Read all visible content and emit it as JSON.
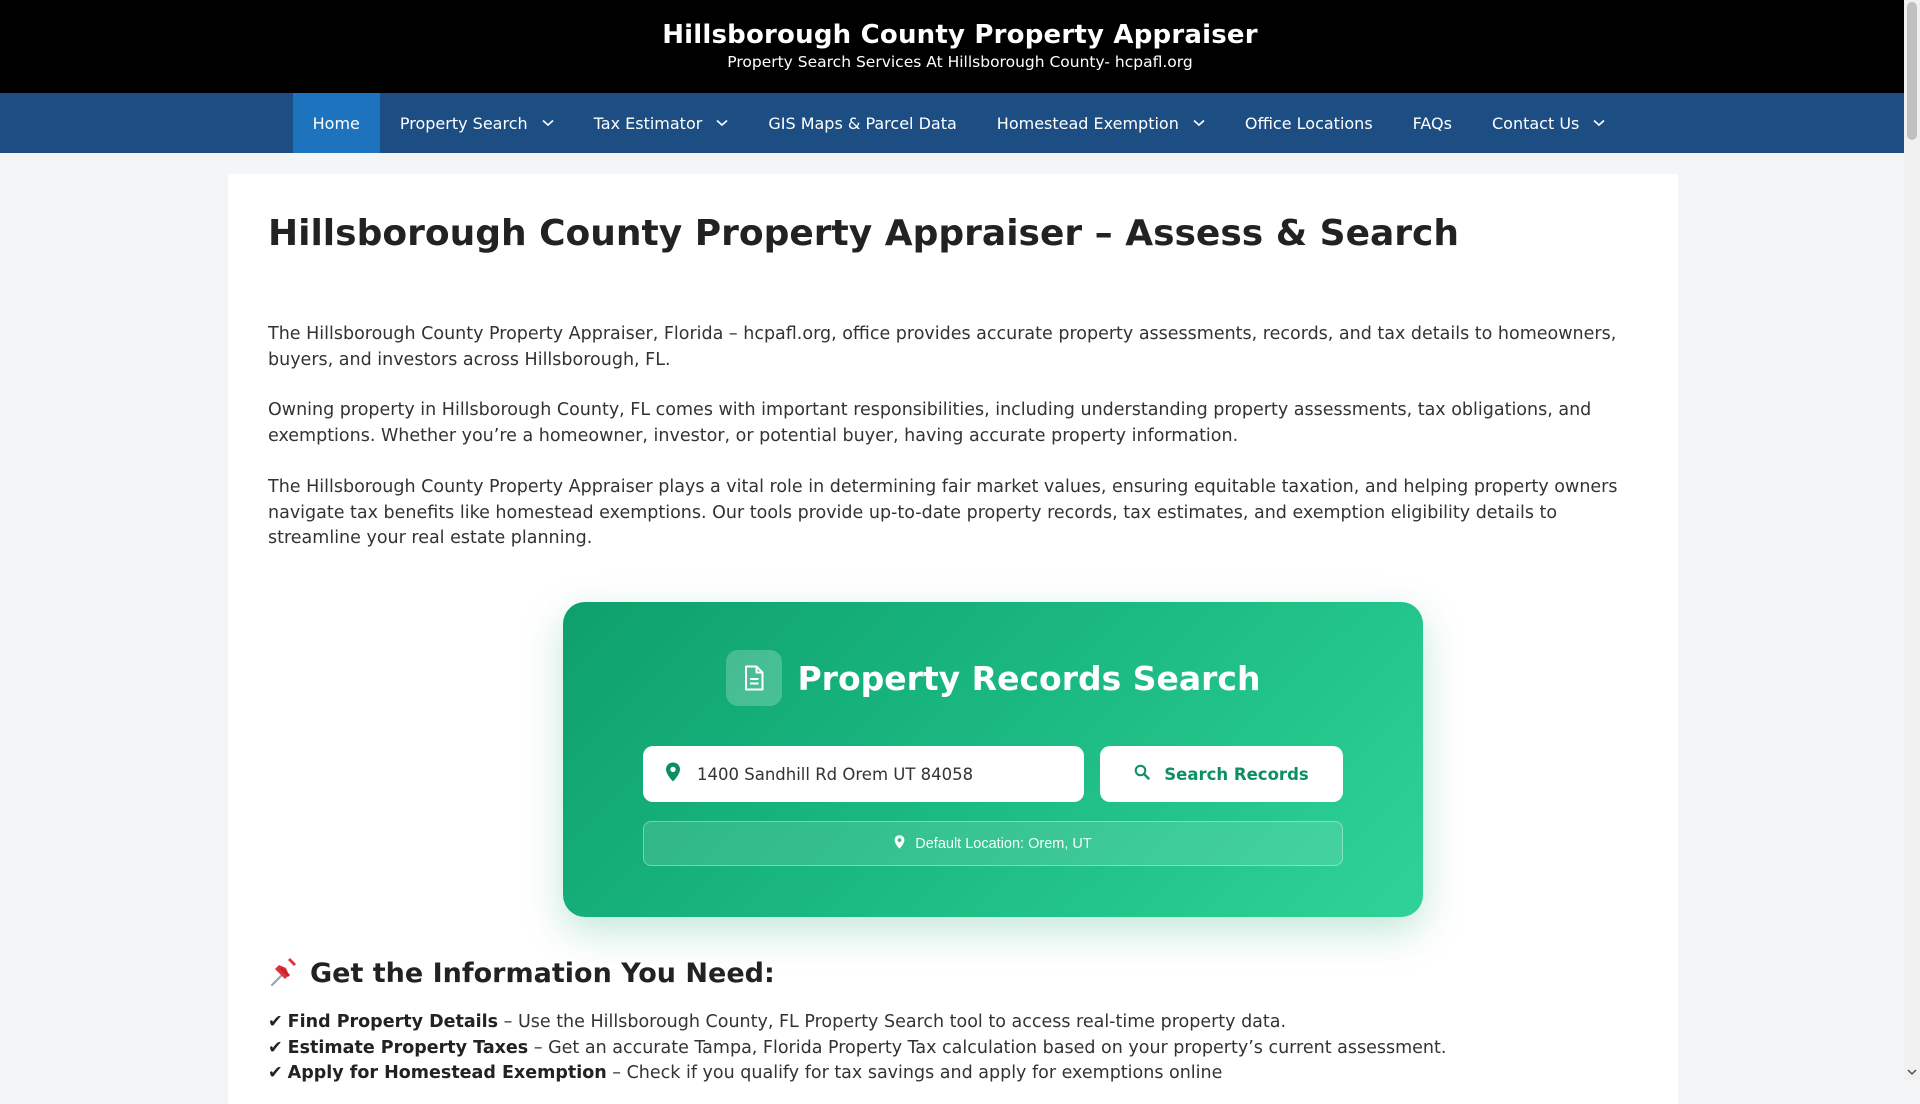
{
  "header": {
    "title": "Hillsborough County Property Appraiser",
    "tagline": "Property Search Services At Hillsborough County- hcpafl.org"
  },
  "nav": {
    "home": "Home",
    "property_search": "Property Search",
    "tax_estimator": "Tax Estimator",
    "gis_maps": "GIS Maps & Parcel Data",
    "homestead": "Homestead Exemption",
    "office_locations": "Office Locations",
    "faqs": "FAQs",
    "contact": "Contact Us"
  },
  "main": {
    "title": "Hillsborough County Property Appraiser – Assess & Search",
    "paragraphs": [
      "The Hillsborough County Property Appraiser, Florida – hcpafl.org, office provides accurate property assessments, records, and tax details to homeowners, buyers, and investors across Hillsborough, FL.",
      "Owning property in Hillsborough County, FL comes with important responsibilities, including understanding property assessments, tax obligations, and exemptions. Whether you’re a homeowner, investor, or potential buyer, having accurate property information.",
      "The Hillsborough County Property Appraiser plays a vital role in determining fair market values, ensuring equitable taxation, and helping property owners navigate tax benefits like homestead exemptions. Our tools provide up-to-date property records, tax estimates, and exemption eligibility details to streamline your real estate planning."
    ]
  },
  "search_widget": {
    "title": "Property Records Search",
    "input_value": "1400 Sandhill Rd Orem UT 84058",
    "button_label": "Search Records",
    "default_location": "Default Location: Orem, UT"
  },
  "info": {
    "heading": "Get the Information You Need:",
    "items": [
      {
        "check": "✔",
        "bold": "Find Property Details",
        "text": " – Use the Hillsborough County, FL Property Search tool to access real-time property data."
      },
      {
        "check": "✔",
        "bold": "Estimate Property Taxes",
        "text": " – Get an accurate Tampa, Florida Property Tax calculation based on your property’s current assessment."
      },
      {
        "check": "✔",
        "bold": "Apply for Homestead Exemption",
        "text": " – Check if you qualify for tax savings and apply for exemptions online"
      }
    ]
  },
  "colors": {
    "header_bg": "#000000",
    "nav_bg": "#1c4e84",
    "nav_active": "#1e73be",
    "widget_gradient_start": "#0ea06c",
    "widget_gradient_end": "#2fd397",
    "button_text": "#0e8f62"
  },
  "icons": {
    "document": "document-icon",
    "location": "location-pin-icon",
    "search": "search-icon",
    "pushpin": "pushpin-icon",
    "chevron": "chevron-down-icon"
  }
}
